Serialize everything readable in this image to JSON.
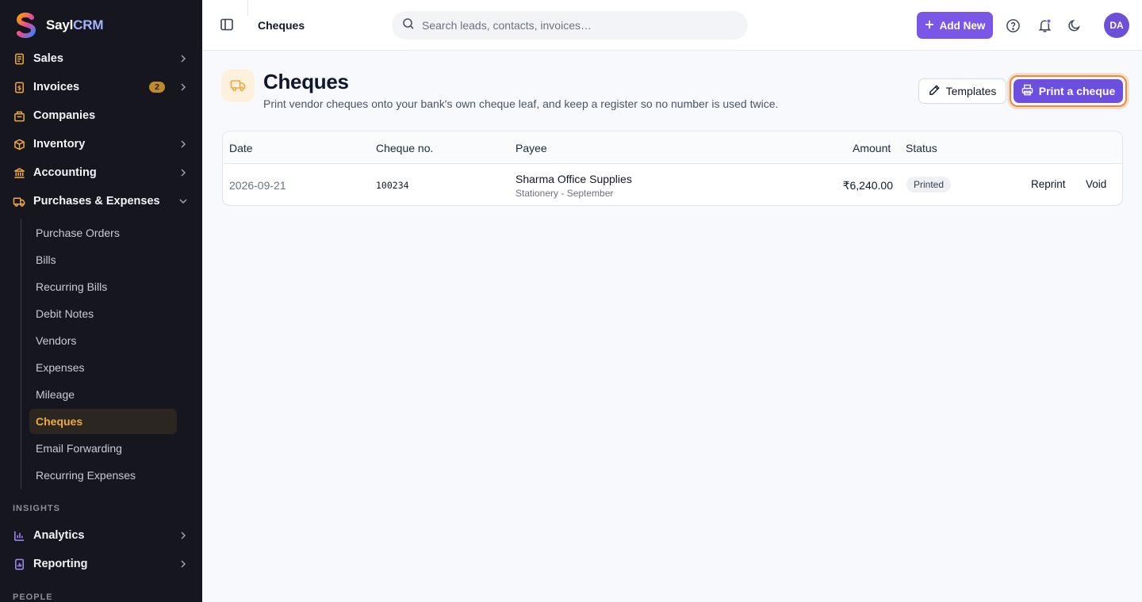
{
  "brand": {
    "name_main": "Sayl",
    "name_accent": "CRM"
  },
  "sidebar": {
    "top_items": [
      {
        "label": "Sales",
        "icon": "receipt-icon",
        "chevron": "right"
      },
      {
        "label": "Invoices",
        "icon": "invoice-icon",
        "badge": "2",
        "chevron": "right"
      },
      {
        "label": "Companies",
        "icon": "building-icon"
      },
      {
        "label": "Inventory",
        "icon": "box-icon",
        "chevron": "right"
      },
      {
        "label": "Accounting",
        "icon": "bank-icon",
        "chevron": "right"
      },
      {
        "label": "Purchases & Expenses",
        "icon": "truck-icon",
        "chevron": "down"
      }
    ],
    "sub_items": [
      "Purchase Orders",
      "Bills",
      "Recurring Bills",
      "Debit Notes",
      "Vendors",
      "Expenses",
      "Mileage",
      "Cheques",
      "Email Forwarding",
      "Recurring Expenses"
    ],
    "active_sub_item": "Cheques",
    "section_insights": "INSIGHTS",
    "insights_items": [
      {
        "label": "Analytics",
        "icon": "bar-chart-icon",
        "chevron": "right"
      },
      {
        "label": "Reporting",
        "icon": "report-icon",
        "chevron": "right"
      }
    ],
    "section_people": "PEOPLE"
  },
  "topbar": {
    "title": "Cheques",
    "search_placeholder": "Search leads, contacts, invoices…",
    "add_new_label": "Add New",
    "avatar_initials": "DA"
  },
  "page": {
    "title": "Cheques",
    "subtitle": "Print vendor cheques onto your bank's own cheque leaf, and keep a register so no number is used twice.",
    "templates_label": "Templates",
    "print_label": "Print a cheque"
  },
  "table": {
    "headers": {
      "date": "Date",
      "cheque_no": "Cheque no.",
      "payee": "Payee",
      "amount": "Amount",
      "status": "Status"
    },
    "rows": [
      {
        "date": "2026-09-21",
        "cheque_no": "100234",
        "payee": "Sharma Office Supplies",
        "memo": "Stationery - September",
        "amount": "₹6,240.00",
        "status": "Printed",
        "actions": [
          "Reprint",
          "Void"
        ]
      }
    ]
  },
  "colors": {
    "sidebar_bg": "#16161f",
    "accent_purple": "#6d4fe0",
    "active_orange": "#f2a93b",
    "badge_gold": "#c08a2b"
  }
}
